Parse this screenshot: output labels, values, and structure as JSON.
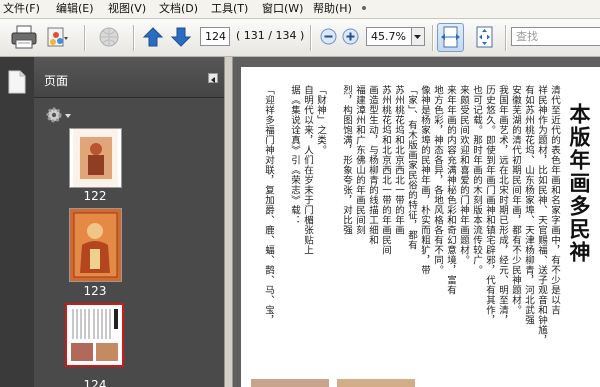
{
  "menu": {
    "items": [
      {
        "label": "文件(F)"
      },
      {
        "label": "编辑(E)"
      },
      {
        "label": "视图(V)"
      },
      {
        "label": "文档(D)"
      },
      {
        "label": "工具(T)"
      },
      {
        "label": "窗口(W)"
      },
      {
        "label": "帮助(H)"
      }
    ]
  },
  "toolbar": {
    "page_number": "124",
    "page_count": "( 131 / 134 )",
    "zoom": "45.7%",
    "search_placeholder": "查找"
  },
  "sidebar": {
    "panel_title": "页面",
    "thumbnails": [
      {
        "label": "122"
      },
      {
        "label": "123"
      },
      {
        "label": "124"
      }
    ]
  },
  "document": {
    "title": "本版年画多民神",
    "columns": [
      "清代至近代的表色年画和名家字画中，有不少是以吉",
      "祥民神作为题材，比如民神、天官赐福、送子观音和钟馗，",
      "有如苏州桃花坞、山东杨家埠、天津杨柳青，河北武强",
      "安徽芜湖的清代初期民间年画，都有不少民神题材。",
      "我国年画艺术，远在北宋时期已形成，经元、明至清，",
      "历史悠久。即使到年画门画神和镇宅辟邪，代有其作，",
      "也可记载。那时年画的木刻版本流传较广。",
      "来颇受民间欢迎和喜爱的门神年画题材。",
      "来年年画的内容充满神秘色彩和奇幻意境，富有",
      "地方色彩，神态各异，各地风格各有不同。",
      "像神是杨家埠的民神年画，朴实而粗犷，带",
      "「家」、有木版画家民俗的特征，都有",
      "苏州桃花坞和北京西北一带的年画",
      "苏州桃花坞和北京西北一带的年画民间",
      "画造型生动，与杨柳青的线描工细和",
      "福建漳州和广东佛山的年画民间刻",
      "烈，构图饱满，形象夸张，对比强",
      "「财神」之类。",
      "自明代以来，人们在岁末于门楣张贴上",
      "据《集说诠真》引《荣志》载：",
      "「迎祥多福门神对联，复加爵、鹿、蝠、鹊、马、宝，"
    ]
  },
  "colors": {
    "sidebar_bg": "#3c3c3c",
    "selected_thumb_border": "#d01818",
    "nav_arrow": "#2a6cc0"
  }
}
